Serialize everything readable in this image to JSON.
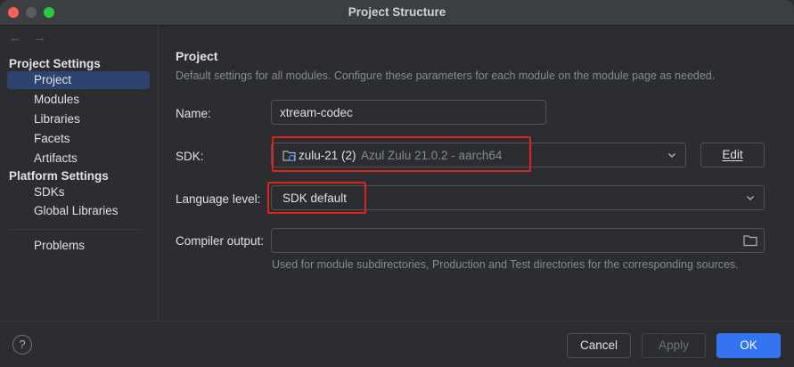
{
  "window": {
    "title": "Project Structure"
  },
  "nav": {
    "back": "←",
    "forward": "→"
  },
  "sidebar": {
    "project_settings_header": "Project Settings",
    "project_settings_items": [
      {
        "label": "Project",
        "selected": true
      },
      {
        "label": "Modules"
      },
      {
        "label": "Libraries"
      },
      {
        "label": "Facets"
      },
      {
        "label": "Artifacts"
      }
    ],
    "platform_settings_header": "Platform Settings",
    "platform_settings_items": [
      {
        "label": "SDKs"
      },
      {
        "label": "Global Libraries"
      }
    ],
    "problems_label": "Problems"
  },
  "main": {
    "heading": "Project",
    "description": "Default settings for all modules. Configure these parameters for each module on the module page as needed.",
    "name": {
      "label": "Name:",
      "value": "xtream-codec"
    },
    "sdk": {
      "label": "SDK:",
      "name": "zulu-21 (2)",
      "detail": "Azul Zulu 21.0.2 - aarch64",
      "edit_label": "Edit",
      "icon": "jdk-folder-icon"
    },
    "language_level": {
      "label": "Language level:",
      "value": "SDK default"
    },
    "compiler_output": {
      "label": "Compiler output:",
      "value": "",
      "hint": "Used for module subdirectories, Production and Test directories for the corresponding sources."
    }
  },
  "footer": {
    "help": "?",
    "cancel": "Cancel",
    "apply": "Apply",
    "ok": "OK"
  },
  "colors": {
    "accent": "#3574f0",
    "selection": "#2e436e",
    "highlight_box": "#e0231a"
  }
}
